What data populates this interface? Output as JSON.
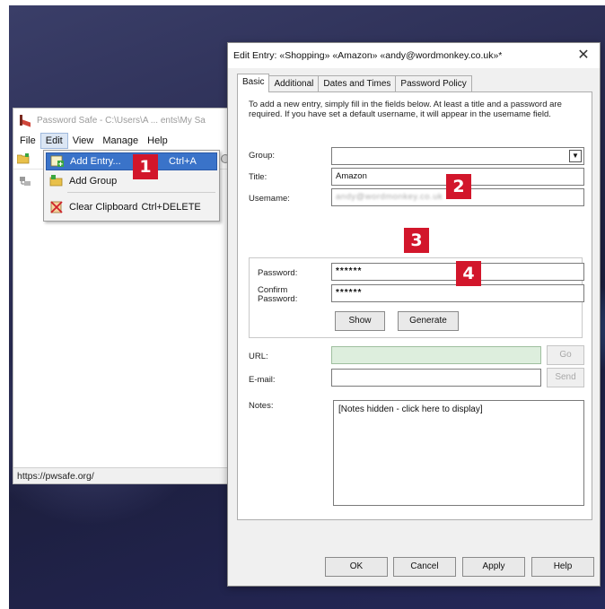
{
  "pw_window": {
    "title": "Password Safe - C:\\Users\\A ... ents\\My Sa",
    "menu": [
      "File",
      "Edit",
      "View",
      "Manage",
      "Help"
    ],
    "status_url": "https://pwsafe.org/"
  },
  "edit_menu": {
    "items": [
      {
        "label": "Add Entry...",
        "shortcut": "Ctrl+A"
      },
      {
        "label": "Add Group",
        "shortcut": ""
      },
      {
        "label": "Clear Clipboard",
        "shortcut": "Ctrl+DELETE"
      }
    ]
  },
  "dialog": {
    "title": "Edit Entry:  «Shopping» «Amazon» «andy@wordmonkey.co.uk»*",
    "tabs": [
      "Basic",
      "Additional",
      "Dates and Times",
      "Password Policy"
    ],
    "active_tab": "Basic",
    "intro": "To add a new entry, simply fill in the fields below. At least a title and a password are required. If you have set a default username, it will appear in the usemame field.",
    "labels": {
      "group": "Group:",
      "title": "Title:",
      "username": "Usemame:",
      "password": "Password:",
      "confirm": "Confirm Password:",
      "url": "URL:",
      "email": "E-mail:",
      "notes": "Notes:"
    },
    "values": {
      "group": "",
      "title": "Amazon",
      "username": "andy@wordmonkey.co.uk",
      "password": "******",
      "confirm": "******",
      "url": "",
      "email": "",
      "notes": "[Notes hidden - click here to display]"
    },
    "buttons": {
      "show": "Show",
      "generate": "Generate",
      "go": "Go",
      "send": "Send",
      "ok": "OK",
      "cancel": "Cancel",
      "apply": "Apply",
      "help": "Help"
    }
  },
  "callouts": [
    "1",
    "2",
    "3",
    "4"
  ],
  "colors": {
    "badge": "#d2162b",
    "menu_highlight": "#3a73c9",
    "url_field": "#ddeedd",
    "desktop": "#2a2c52"
  }
}
